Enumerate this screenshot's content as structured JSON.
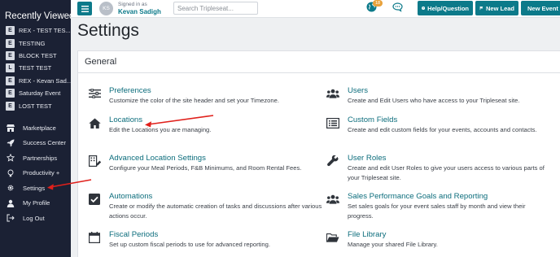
{
  "sidebar": {
    "recently_viewed_title": "Recently Viewed",
    "recent_items": [
      {
        "badge": "E",
        "label": "REX - TEST TES..."
      },
      {
        "badge": "E",
        "label": "TESTING"
      },
      {
        "badge": "E",
        "label": "BLOCK TEST"
      },
      {
        "badge": "L",
        "label": "TEST TEST"
      },
      {
        "badge": "E",
        "label": "REX - Kevan Sad..."
      },
      {
        "badge": "E",
        "label": "Saturday Event"
      },
      {
        "badge": "E",
        "label": "LOST TEST"
      }
    ],
    "nav": [
      {
        "icon": "store-icon",
        "label": "Marketplace"
      },
      {
        "icon": "rocket-icon",
        "label": "Success Center"
      },
      {
        "icon": "star-icon",
        "label": "Partnerships"
      },
      {
        "icon": "lightbulb-icon",
        "label": "Productivity +"
      },
      {
        "icon": "gear-icon",
        "label": "Settings"
      },
      {
        "icon": "user-icon",
        "label": "My Profile"
      },
      {
        "icon": "logout-icon",
        "label": "Log Out"
      }
    ]
  },
  "topbar": {
    "avatar_initials": "KS",
    "signed_in_as": "Signed in as",
    "user_name": "Kevan Sadigh",
    "search_placeholder": "Search Tripleseat...",
    "notification_count": "18",
    "help_button": "Help/Question",
    "new_lead_button": "New Lead",
    "new_event_button": "New Event"
  },
  "page": {
    "title": "Settings",
    "section_title": "General"
  },
  "settings_items": [
    {
      "icon": "sliders-icon",
      "title": "Preferences",
      "desc": "Customize the color of the site header and set your Timezone."
    },
    {
      "icon": "users-icon",
      "title": "Users",
      "desc": "Create and Edit Users who have access to your Tripleseat site."
    },
    {
      "icon": "home-icon",
      "title": "Locations",
      "desc": "Edit the Locations you are managing."
    },
    {
      "icon": "list-icon",
      "title": "Custom Fields",
      "desc": "Create and edit custom fields for your events, accounts and contacts."
    },
    {
      "icon": "building-edit-icon",
      "title": "Advanced Location Settings",
      "desc": "Configure your Meal Periods, F&B Minimums, and Room Rental Fees."
    },
    {
      "icon": "wrench-icon",
      "title": "User Roles",
      "desc": "Create and edit User Roles to give your users access to various parts of your Tripleseat site."
    },
    {
      "icon": "check-square-icon",
      "title": "Automations",
      "desc": "Create or modify the automatic creation of tasks and discussions after various actions occur."
    },
    {
      "icon": "users-icon",
      "title": "Sales Performance Goals and Reporting",
      "desc": "Set sales goals for your event sales staff by month and view their progress."
    },
    {
      "icon": "calendar-icon",
      "title": "Fiscal Periods",
      "desc": "Set up custom fiscal periods to use for advanced reporting."
    },
    {
      "icon": "folder-open-icon",
      "title": "File Library",
      "desc": "Manage your shared File Library."
    }
  ],
  "colors": {
    "sidebar_bg": "#1b2134",
    "accent": "#0c7a8a",
    "link": "#0c6d7c",
    "annotation_arrow": "#e0201b",
    "notification_badge": "#e8a13a"
  }
}
